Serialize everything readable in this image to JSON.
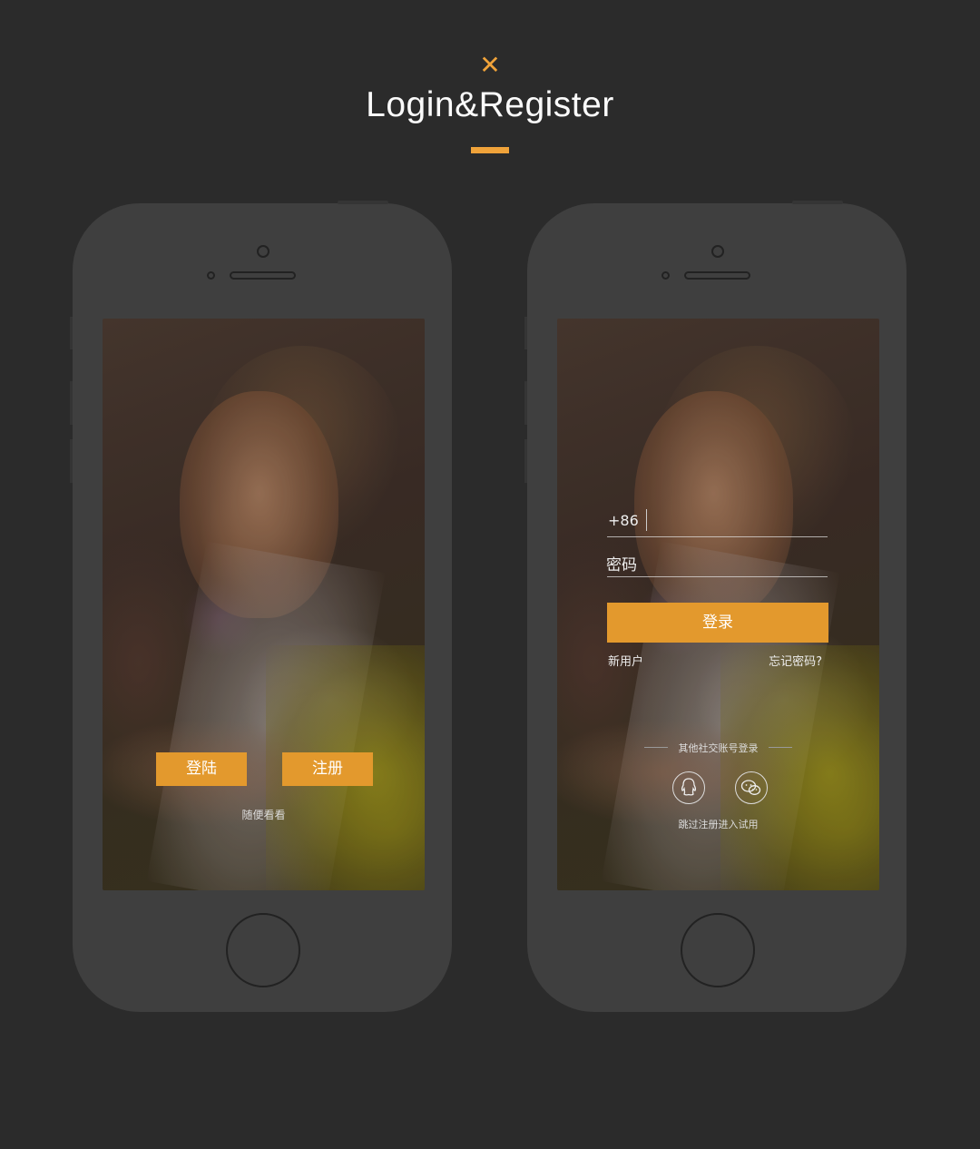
{
  "header": {
    "icon": "close-icon",
    "accent_color": "#f0a33a",
    "title": "Login&Register"
  },
  "left_screen": {
    "login_label": "登陆",
    "register_label": "注册",
    "browse_label": "随便看看"
  },
  "right_screen": {
    "phone_prefix": "+86",
    "password_placeholder": "密码",
    "login_label": "登录",
    "new_user_label": "新用户",
    "forgot_label": "忘记密码?",
    "social_title": "其他社交账号登录",
    "social_icons": [
      "qq-icon",
      "wechat-icon"
    ],
    "skip_label": "跳过注册进入试用"
  }
}
